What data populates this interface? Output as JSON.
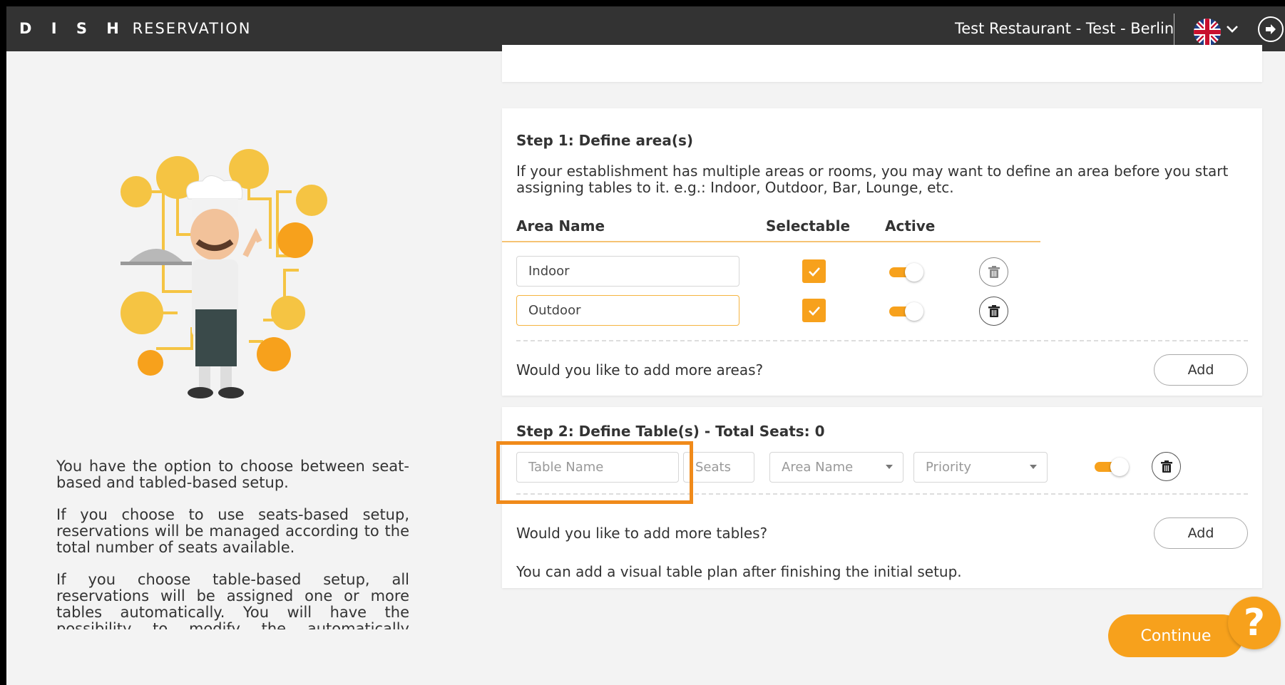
{
  "header": {
    "brand_bold": "D I S H",
    "brand_rest": "RESERVATION",
    "restaurant": "Test Restaurant - Test - Berlin",
    "language_icon": "uk-flag-icon",
    "chevron_icon": "chevron-down-icon",
    "logout_icon": "logout-icon"
  },
  "info": {
    "paragraphs": [
      "You have the option to choose between seat-based and tabled-based setup.",
      "If you choose to use seats-based setup, reservations will be managed according to the total number of seats available.",
      "If you choose table-based setup, all reservations will be assigned one or more tables automatically. You will have the possibility to modify the automatically assigned tables. Only"
    ]
  },
  "step1": {
    "title": "Step 1: Define area(s)",
    "description": "If your establishment has multiple areas or rooms, you may want to define an area before you start assigning tables to it. e.g.: Indoor, Outdoor, Bar, Lounge, etc.",
    "columns": {
      "name": "Area Name",
      "selectable": "Selectable",
      "active": "Active"
    },
    "areas": [
      {
        "name": "Indoor",
        "selectable": true,
        "active": true
      },
      {
        "name": "Outdoor",
        "selectable": true,
        "active": true
      }
    ],
    "add_prompt": "Would you like to add more areas?",
    "add_label": "Add"
  },
  "step2": {
    "title": "Step 2: Define Table(s) - Total Seats: 0",
    "table_name_placeholder": "Table Name",
    "seats_placeholder": "Seats",
    "area_placeholder": "Area Name",
    "priority_placeholder": "Priority",
    "active": true,
    "add_prompt": "Would you like to add more tables?",
    "add_label": "Add",
    "note": "You can add a visual table plan after finishing the initial setup."
  },
  "footer": {
    "continue_label": "Continue",
    "help_label": "?"
  },
  "colors": {
    "accent": "#f7a11c",
    "topbar": "#333333",
    "highlight": "#f08a1a"
  }
}
